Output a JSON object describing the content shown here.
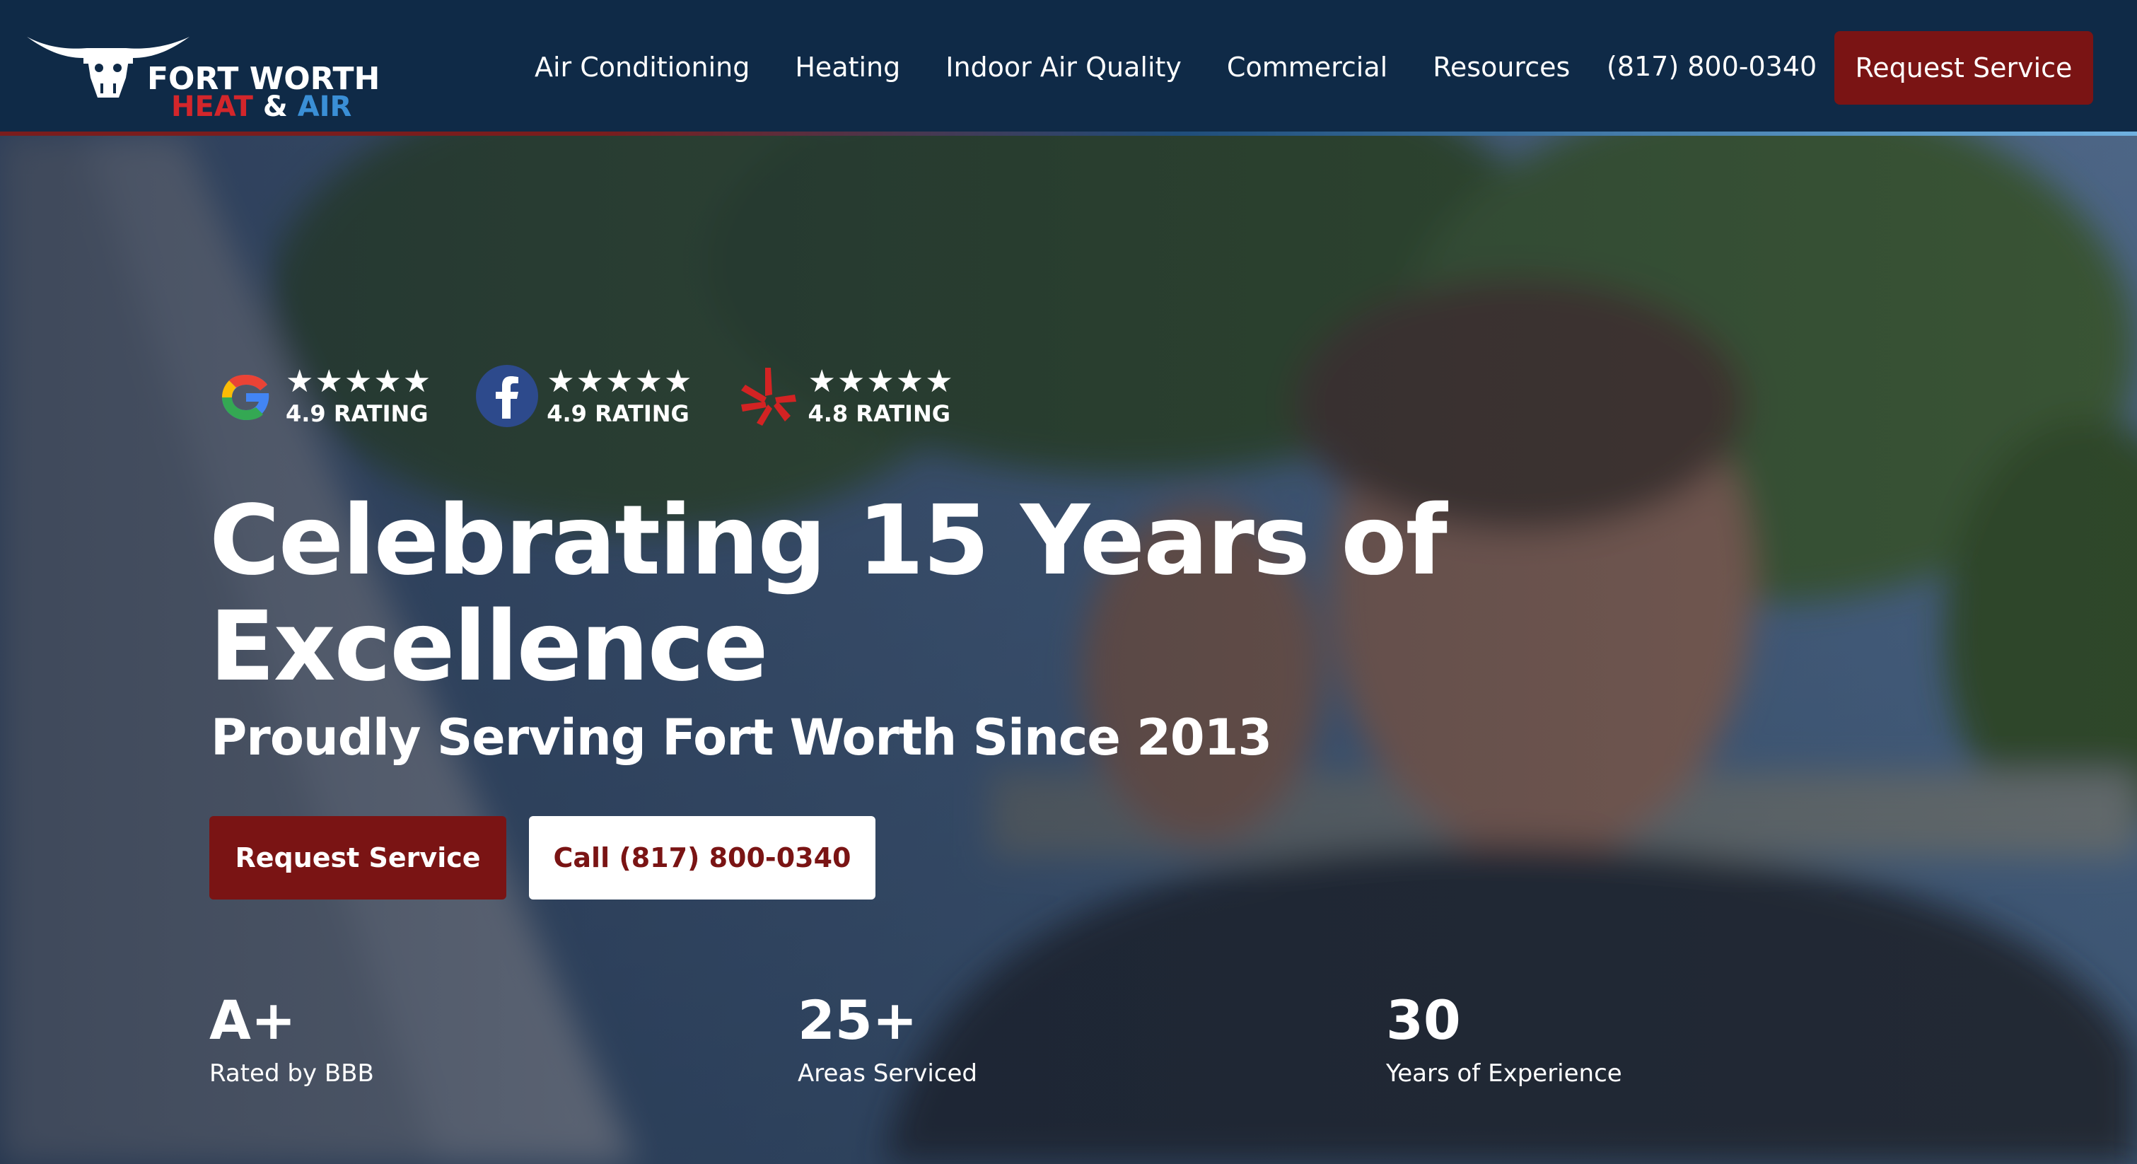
{
  "logo": {
    "line1": "FORT WORTH",
    "heat": "HEAT",
    "amp": "&",
    "air": "AIR"
  },
  "nav": {
    "items": [
      {
        "label": "Air Conditioning"
      },
      {
        "label": "Heating"
      },
      {
        "label": "Indoor Air Quality"
      },
      {
        "label": "Commercial"
      },
      {
        "label": "Resources"
      }
    ],
    "phone": "(817) 800-0340",
    "cta": "Request Service"
  },
  "hero": {
    "ratings": [
      {
        "source_icon": "google-icon",
        "stars": "★★★★★",
        "text": "4.9 RATING"
      },
      {
        "source_icon": "facebook-icon",
        "stars": "★★★★★",
        "text": "4.9 RATING"
      },
      {
        "source_icon": "yelp-icon",
        "stars": "★★★★★",
        "text": "4.8 RATING"
      }
    ],
    "title": "Celebrating 15 Years of Excellence",
    "subtitle": "Proudly Serving Fort Worth Since 2013",
    "primary_button": "Request Service",
    "secondary_button": "Call (817) 800-0340",
    "stats": [
      {
        "value": "A+",
        "label": "Rated by BBB"
      },
      {
        "value": "25+",
        "label": "Areas Serviced"
      },
      {
        "value": "30",
        "label": "Years of Experience"
      }
    ]
  },
  "colors": {
    "header_bg": "#0f2a47",
    "brand_red": "#7a1414",
    "heat_red": "#d3262b",
    "air_blue": "#3a8fd6",
    "white": "#ffffff"
  }
}
